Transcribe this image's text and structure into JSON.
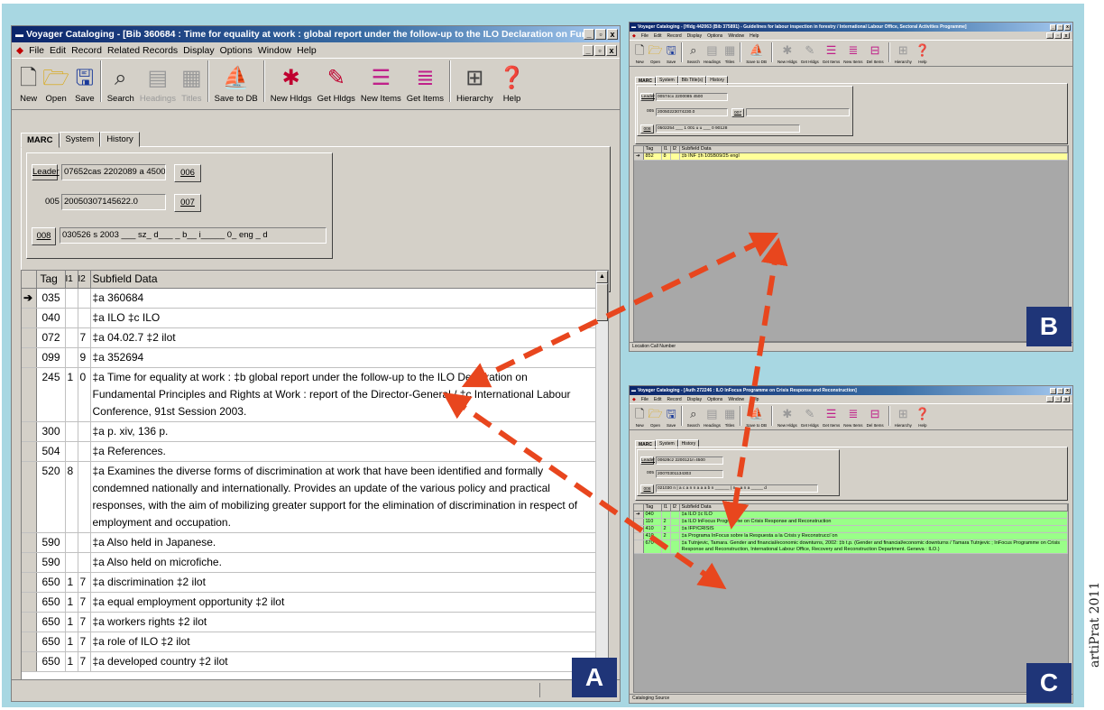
{
  "credit": "artiPrat 2011",
  "toolbar_icons": [
    "new",
    "open",
    "save",
    "search",
    "headings",
    "titles",
    "save-to-db",
    "new-holdings",
    "get-holdings",
    "new-items",
    "get-items",
    "hierarchy",
    "help"
  ],
  "win_a": {
    "title": "Voyager Cataloging - [Bib 360684 : Time for equality at work : global report under the follow-up to the ILO Declaration on Fundamental Principles and Rights a]",
    "badge": "A",
    "menu": [
      "File",
      "Edit",
      "Record",
      "Related Records",
      "Display",
      "Options",
      "Window",
      "Help"
    ],
    "toolbar": [
      "New",
      "Open",
      "Save",
      "Search",
      "Headings",
      "Titles",
      "Save to DB",
      "New Hldgs",
      "Get Hldgs",
      "New Items",
      "Get Items",
      "Hierarchy",
      "Help"
    ],
    "tabs": [
      "MARC",
      "System",
      "History"
    ],
    "leader_label": "Leader",
    "leader_value": "07652cas 2202089 a 4500",
    "btn_006": "006",
    "label_005": "005",
    "value_005": "20050307145622.0",
    "btn_007": "007",
    "btn_008": "008",
    "value_008": "030526 s 2003 ___ sz_ d___ _ b__ i_____ 0_ eng _ d",
    "columns": [
      "Tag",
      "I1",
      "I2",
      "Subfield Data"
    ],
    "rows": [
      {
        "tag": "035",
        "i1": "",
        "i2": "",
        "data": "‡a 360684"
      },
      {
        "tag": "040",
        "i1": "",
        "i2": "",
        "data": "‡a ILO ‡c ILO"
      },
      {
        "tag": "072",
        "i1": "",
        "i2": "7",
        "data": "‡a 04.02.7 ‡2 ilot"
      },
      {
        "tag": "099",
        "i1": "",
        "i2": "9",
        "data": "‡a 352694"
      },
      {
        "tag": "245",
        "i1": "1",
        "i2": "0",
        "data": "‡a Time for equality at work : ‡b global report under the follow-up to the ILO Declaration on Fundamental Principles and Rights at Work : report of the Director-General / ‡c International Labour Conference, 91st Session 2003."
      },
      {
        "tag": "300",
        "i1": "",
        "i2": "",
        "data": "‡a p. xiv, 136 p."
      },
      {
        "tag": "504",
        "i1": "",
        "i2": "",
        "data": "‡a References."
      },
      {
        "tag": "520",
        "i1": "8",
        "i2": "",
        "data": "‡a Examines the diverse forms of discrimination at work that have been identified and formally condemned nationally and internationally. Provides an update of the various policy and practical responses, with the aim of mobilizing greater support for the elimination of discrimination in respect of employment and occupation."
      },
      {
        "tag": "590",
        "i1": "",
        "i2": "",
        "data": "‡a Also held in Japanese."
      },
      {
        "tag": "590",
        "i1": "",
        "i2": "",
        "data": "‡a Also held on microfiche."
      },
      {
        "tag": "650",
        "i1": "1",
        "i2": "7",
        "data": "‡a discrimination ‡2 ilot"
      },
      {
        "tag": "650",
        "i1": "1",
        "i2": "7",
        "data": "‡a equal employment opportunity ‡2 ilot"
      },
      {
        "tag": "650",
        "i1": "1",
        "i2": "7",
        "data": "‡a workers rights ‡2 ilot"
      },
      {
        "tag": "650",
        "i1": "1",
        "i2": "7",
        "data": "‡a role of ILO ‡2 ilot"
      },
      {
        "tag": "650",
        "i1": "1",
        "i2": "7",
        "data": "‡a developed country ‡2 ilot"
      }
    ]
  },
  "win_b": {
    "title": "Voyager Cataloging - [Hldg 442063 (Bib 375891) - Guidelines for labour inspection in forestry / International Labour Office, Sectoral Activities Programme]",
    "badge": "B",
    "menu": [
      "File",
      "Edit",
      "Record",
      "Display",
      "Options",
      "Window",
      "Help"
    ],
    "toolbar": [
      "New",
      "Open",
      "Save",
      "Search",
      "Headings",
      "Titles",
      "Save to DB",
      "New Hldgs",
      "Get Hldgs",
      "Get Items",
      "New Items",
      "Del Items",
      "Hierarchy",
      "Help"
    ],
    "tabs": [
      "MARC",
      "System",
      "Bib Title(s)",
      "History"
    ],
    "leader_label": "Leader",
    "leader_value": "00574cx 2200085 4500",
    "label_005": "005",
    "value_005": "20050223074230.0",
    "btn_007": "007",
    "btn_008": "008",
    "value_008": "0502254 ___ 1 001 u u ___ 0 90128",
    "columns": [
      "Tag",
      "I1",
      "I2",
      "Subfield Data"
    ],
    "rows": [
      {
        "tag": "852",
        "i1": "8",
        "i2": "",
        "data": "‡b INF ‡h 105B09/25 engl"
      }
    ],
    "status": "Location Call Number"
  },
  "win_c": {
    "title": "Voyager Cataloging - [Auth 272246 : ILO InFocus Programme on Crisis Response and Reconstruction]",
    "badge": "C",
    "menu": [
      "File",
      "Edit",
      "Record",
      "Display",
      "Options",
      "Window",
      "Help"
    ],
    "toolbar": [
      "New",
      "Open",
      "Save",
      "Search",
      "Headings",
      "Titles",
      "Save to DB",
      "New Hldgs",
      "Get Hldgs",
      "Get Items",
      "New Items",
      "Del Items",
      "Hierarchy",
      "Help"
    ],
    "tabs": [
      "MARC",
      "System",
      "History"
    ],
    "leader_label": "Leader",
    "leader_value": "00628cz 2200121n 4500",
    "label_005": "005",
    "value_005": "20070301134303",
    "btn_008": "008",
    "value_008": "021030 n | a c a n n a a a b n ______ | n _ a n a _____ d",
    "columns": [
      "Tag",
      "I1",
      "I2",
      "Subfield Data"
    ],
    "rows": [
      {
        "tag": "040",
        "i1": "",
        "i2": "",
        "data": "‡a ILO ‡c ILO"
      },
      {
        "tag": "110",
        "i1": "2",
        "i2": "",
        "data": "‡a ILO InFocus Programme on Crisis Response and Reconstruction"
      },
      {
        "tag": "410",
        "i1": "2",
        "i2": "",
        "data": "‡a IFP/CRISIS"
      },
      {
        "tag": "410",
        "i1": "2",
        "i2": "",
        "data": "‡a Programa InFocus sobre la Respuesta a la Crisis y Reconstrucci¨on"
      },
      {
        "tag": "670",
        "i1": "",
        "i2": "",
        "data": "‡a Tutnjevic, Tamara. Gender and financial/economic downturns, 2002: ‡b t.p. (Gender and financial/economic downturns / Tamara Tutnjevic ; InFocus Programme on Crisis Response and Reconstruction, International Labour Office, Recovery and Reconstruction Department. Geneva : ILO.)"
      }
    ],
    "status": "Cataloging Source"
  }
}
